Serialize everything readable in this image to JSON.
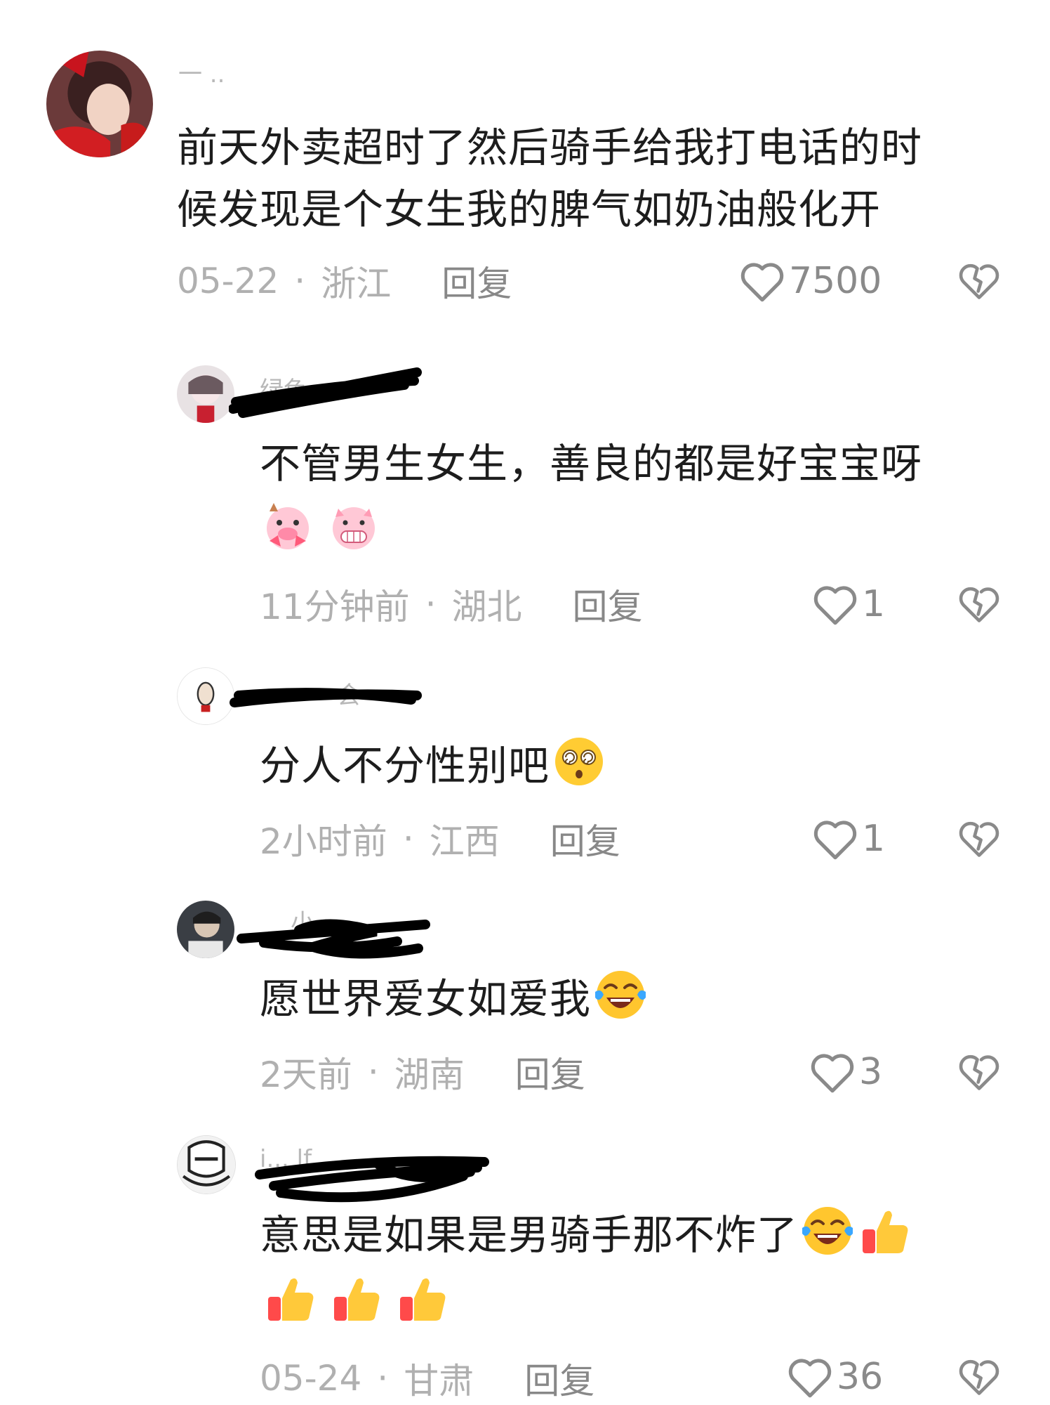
{
  "comments": [
    {
      "username": "一 ..",
      "text_lines": [
        "前天外卖超时了然后骑手给我打电话的时",
        "候发现是个女生我的脾气如奶油般化开"
      ],
      "date": "05-22",
      "location": "浙江",
      "reply_label": "回复",
      "likes": "7500",
      "emojis": []
    },
    {
      "username": "绿色",
      "text": "不管男生女生，善良的都是好宝宝呀",
      "emojis": [
        "pig-heart-emoji",
        "pig-grin-emoji"
      ],
      "date": "11分钟前",
      "location": "湖北",
      "reply_label": "回复",
      "likes": "1"
    },
    {
      "username": "会",
      "text": "分人不分性别吧",
      "emojis": [
        "dizzy-face-emoji"
      ],
      "date": "2小时前",
      "location": "江西",
      "reply_label": "回复",
      "likes": "1"
    },
    {
      "username": "小",
      "text": "愿世界爱女如爱我",
      "emojis": [
        "laughing-crying-emoji"
      ],
      "date": "2天前",
      "location": "湖南",
      "reply_label": "回复",
      "likes": "3"
    },
    {
      "username": "i... lf",
      "text": "意思是如果是男骑手那不炸了",
      "emojis": [
        "laughing-crying-emoji",
        "thumbs-up-emoji",
        "thumbs-up-emoji",
        "thumbs-up-emoji",
        "thumbs-up-emoji"
      ],
      "date": "05-24",
      "location": "甘肃",
      "reply_label": "回复",
      "likes": "36"
    }
  ],
  "separator": "·",
  "colors": {
    "meta": "#b0b0b0",
    "text": "#1d1d1d",
    "icon": "#8a8a8a"
  }
}
